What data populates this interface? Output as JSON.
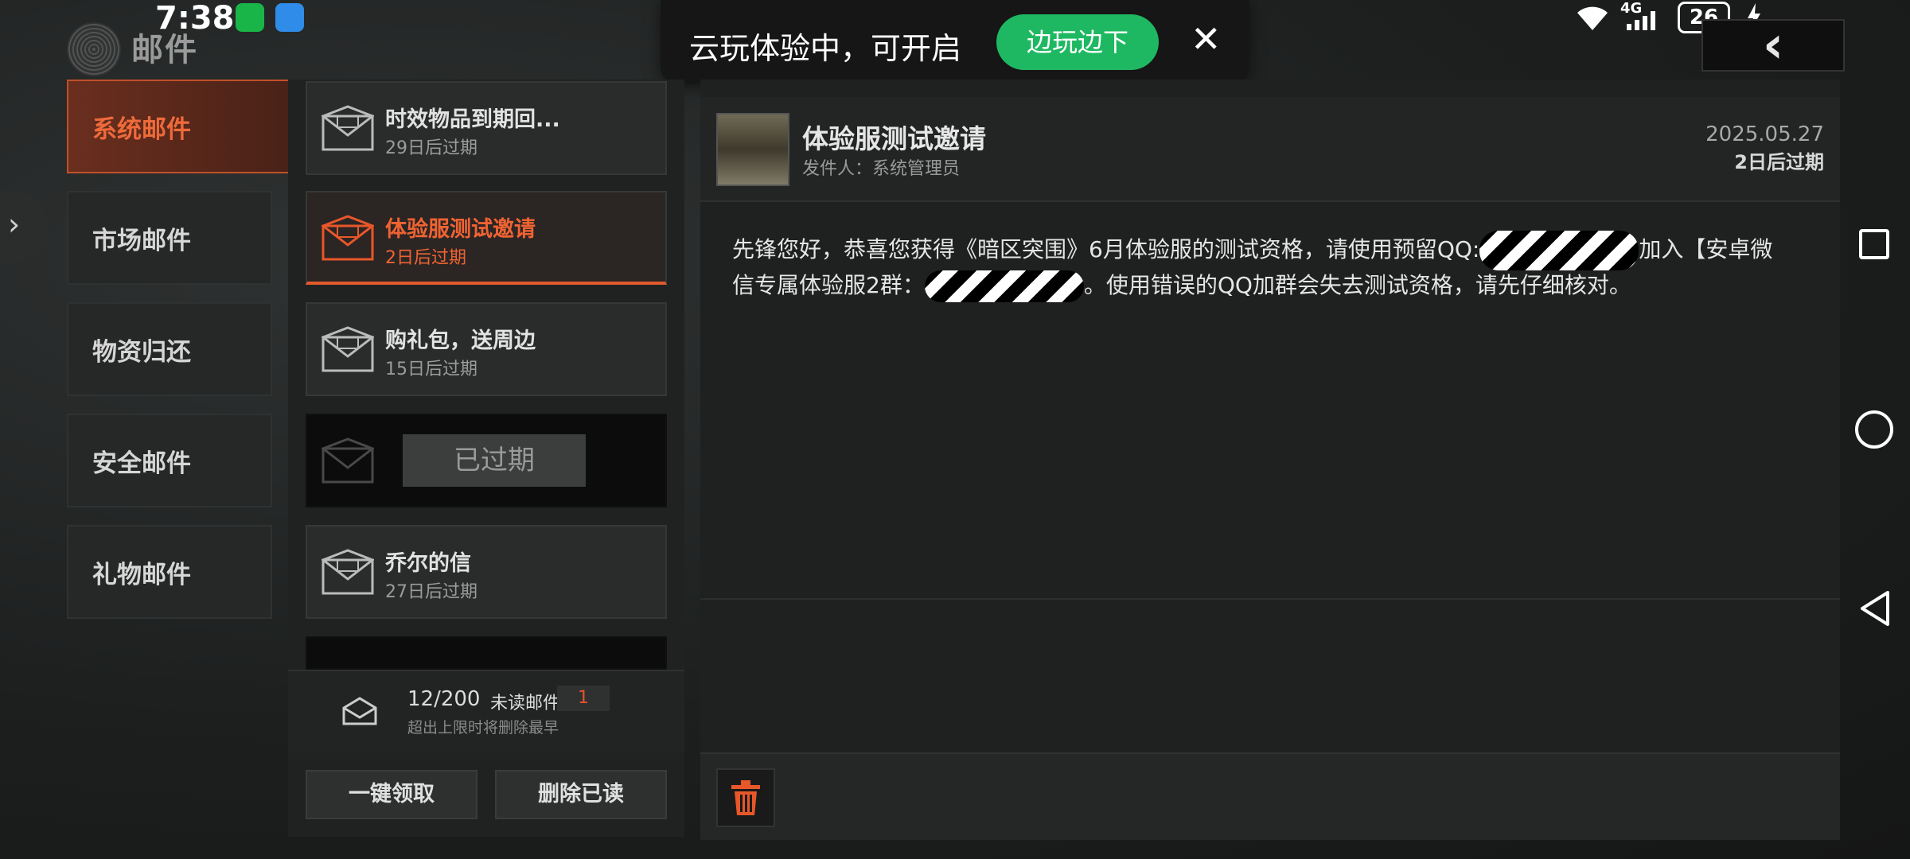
{
  "status_bar": {
    "time": "7:38",
    "network": "4G",
    "battery": "26",
    "icons": [
      "wechat-icon",
      "weather-icon",
      "wifi-icon",
      "signal-icon",
      "battery-icon",
      "charging-icon"
    ]
  },
  "header": {
    "title": "邮件",
    "back_icon": "chevron-left-icon"
  },
  "toast": {
    "text": "云玩体验中，可开启",
    "button": "边玩边下",
    "close": "✕"
  },
  "categories": [
    {
      "label": "系统邮件",
      "active": true
    },
    {
      "label": "市场邮件",
      "active": false
    },
    {
      "label": "物资归还",
      "active": false
    },
    {
      "label": "安全邮件",
      "active": false
    },
    {
      "label": "礼物邮件",
      "active": false
    }
  ],
  "mails": [
    {
      "title": "时效物品到期回...",
      "sub": "29日后过期",
      "state": "normal"
    },
    {
      "title": "体验服测试邀请",
      "sub": "2日后过期",
      "state": "active"
    },
    {
      "title": "购礼包，送周边",
      "sub": "15日后过期",
      "state": "normal"
    },
    {
      "title": "",
      "sub": "",
      "state": "expired",
      "badge": "已过期"
    },
    {
      "title": "乔尔的信",
      "sub": "27日后过期",
      "state": "normal"
    }
  ],
  "list_footer": {
    "count": "12/200",
    "unread_label": "未读邮件",
    "unread_count": "1",
    "note": "超出上限时将删除最早",
    "claim_all": "一键领取",
    "delete_read": "删除已读"
  },
  "detail": {
    "title": "体验服测试邀请",
    "sender": "发件人：系统管理员",
    "date": "2025.05.27",
    "expiry": "2日后过期",
    "body_part1": "先锋您好，恭喜您获得《暗区突围》6月体验服的测试资格，请使用预留QQ:",
    "body_part2": "加入【安卓微信专属体验服2群：",
    "body_part3": "。使用错误的QQ加群会失去测试资格，请先仔细核对。",
    "delete_icon": "trash-icon"
  },
  "colors": {
    "accent": "#e8572a",
    "toast_button": "#1fb862",
    "background": "#1c1d1d"
  }
}
